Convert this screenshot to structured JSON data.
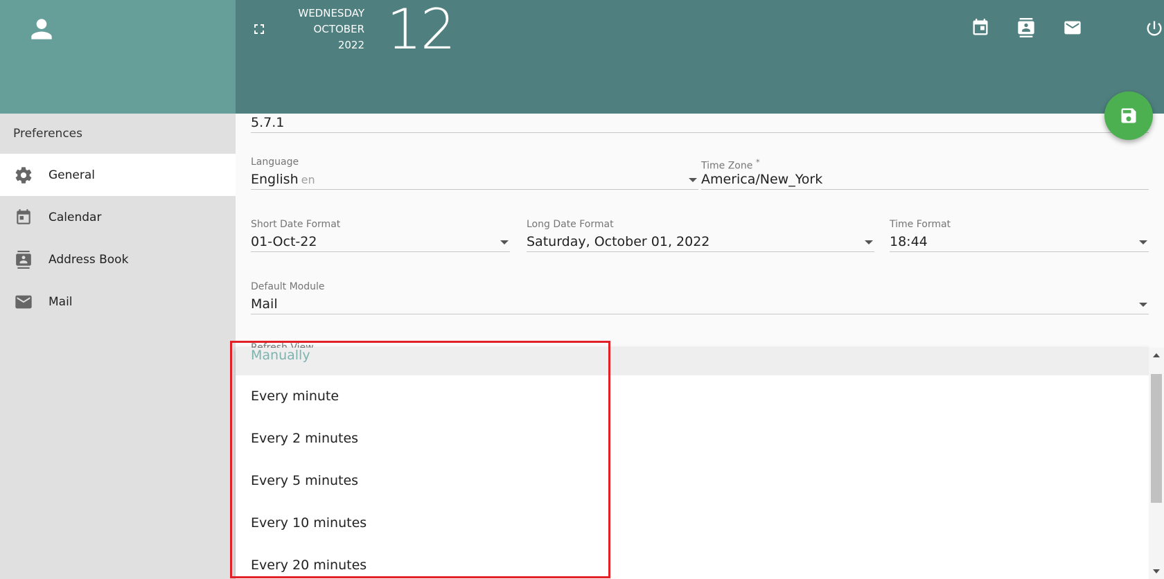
{
  "sidebar": {
    "header": "Preferences",
    "items": [
      {
        "label": "General",
        "icon": "gear-icon",
        "active": true
      },
      {
        "label": "Calendar",
        "icon": "calendar-icon"
      },
      {
        "label": "Address Book",
        "icon": "contacts-icon"
      },
      {
        "label": "Mail",
        "icon": "mail-icon"
      }
    ]
  },
  "topbar": {
    "weekday": "WEDNESDAY",
    "month": "OCTOBER",
    "year": "2022",
    "day": "12",
    "icons": [
      "fullscreen-icon",
      "calendar-icon",
      "contacts-icon",
      "mail-icon",
      "power-icon"
    ]
  },
  "form": {
    "version_value": "5.7.1",
    "language": {
      "label": "Language",
      "value": "English",
      "code": "en"
    },
    "timezone": {
      "label": "Time Zone",
      "required_mark": "*",
      "value": "America/New_York"
    },
    "short_date": {
      "label": "Short Date Format",
      "value": "01-Oct-22"
    },
    "long_date": {
      "label": "Long Date Format",
      "value": "Saturday, October 01, 2022"
    },
    "time_format": {
      "label": "Time Format",
      "value": "18:44"
    },
    "default_module": {
      "label": "Default Module",
      "value": "Mail"
    },
    "refresh_view": {
      "label": "Refresh View"
    }
  },
  "dropdown": {
    "options": [
      "Manually",
      "Every minute",
      "Every 2 minutes",
      "Every 5 minutes",
      "Every 10 minutes",
      "Every 20 minutes"
    ],
    "selected": "Manually"
  },
  "colors": {
    "sidebar_top": "#669e99",
    "topbar": "#4f807f",
    "fab": "#4caf50",
    "highlight": "#e02127",
    "selected_text": "#7db3ae"
  }
}
